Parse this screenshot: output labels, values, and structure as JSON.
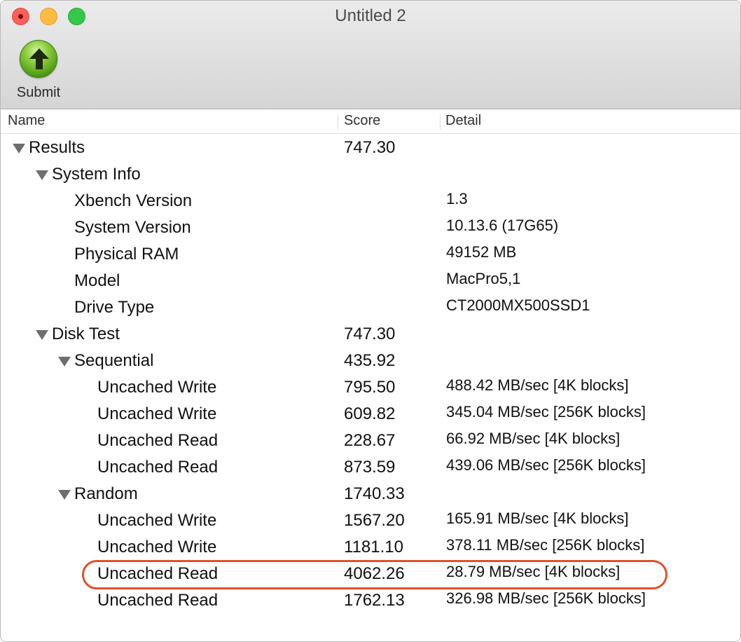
{
  "window": {
    "title": "Untitled 2"
  },
  "toolbar": {
    "submit_label": "Submit"
  },
  "columns": {
    "name": "Name",
    "score": "Score",
    "detail": "Detail"
  },
  "rows": [
    {
      "level": 0,
      "disclosure": true,
      "name": "Results",
      "score": "747.30",
      "detail": ""
    },
    {
      "level": 1,
      "disclosure": true,
      "name": "System Info",
      "score": "",
      "detail": ""
    },
    {
      "level": 2,
      "disclosure": false,
      "name": "Xbench Version",
      "score": "",
      "detail": "1.3"
    },
    {
      "level": 2,
      "disclosure": false,
      "name": "System Version",
      "score": "",
      "detail": "10.13.6 (17G65)"
    },
    {
      "level": 2,
      "disclosure": false,
      "name": "Physical RAM",
      "score": "",
      "detail": "49152 MB"
    },
    {
      "level": 2,
      "disclosure": false,
      "name": "Model",
      "score": "",
      "detail": "MacPro5,1"
    },
    {
      "level": 2,
      "disclosure": false,
      "name": "Drive Type",
      "score": "",
      "detail": "CT2000MX500SSD1"
    },
    {
      "level": 1,
      "disclosure": true,
      "name": "Disk Test",
      "score": "747.30",
      "detail": ""
    },
    {
      "level": 2,
      "disclosure": true,
      "name": "Sequential",
      "score": "435.92",
      "detail": ""
    },
    {
      "level": 3,
      "disclosure": false,
      "name": "Uncached Write",
      "score": "795.50",
      "detail": "488.42 MB/sec [4K blocks]"
    },
    {
      "level": 3,
      "disclosure": false,
      "name": "Uncached Write",
      "score": "609.82",
      "detail": "345.04 MB/sec [256K blocks]"
    },
    {
      "level": 3,
      "disclosure": false,
      "name": "Uncached Read",
      "score": "228.67",
      "detail": "66.92 MB/sec [4K blocks]"
    },
    {
      "level": 3,
      "disclosure": false,
      "name": "Uncached Read",
      "score": "873.59",
      "detail": "439.06 MB/sec [256K blocks]"
    },
    {
      "level": 2,
      "disclosure": true,
      "name": "Random",
      "score": "1740.33",
      "detail": ""
    },
    {
      "level": 3,
      "disclosure": false,
      "name": "Uncached Write",
      "score": "1567.20",
      "detail": "165.91 MB/sec [4K blocks]"
    },
    {
      "level": 3,
      "disclosure": false,
      "name": "Uncached Write",
      "score": "1181.10",
      "detail": "378.11 MB/sec [256K blocks]"
    },
    {
      "level": 3,
      "disclosure": false,
      "name": "Uncached Read",
      "score": "4062.26",
      "detail": "28.79 MB/sec [4K blocks]",
      "highlighted": true
    },
    {
      "level": 3,
      "disclosure": false,
      "name": "Uncached Read",
      "score": "1762.13",
      "detail": "326.98 MB/sec [256K blocks]"
    }
  ],
  "colors": {
    "highlight": "#e0522a",
    "disclosure": "#6e6e6e"
  },
  "icons": {
    "submit": "green-up-arrow-icon",
    "disclosure": "disclosure-triangle-icon"
  }
}
